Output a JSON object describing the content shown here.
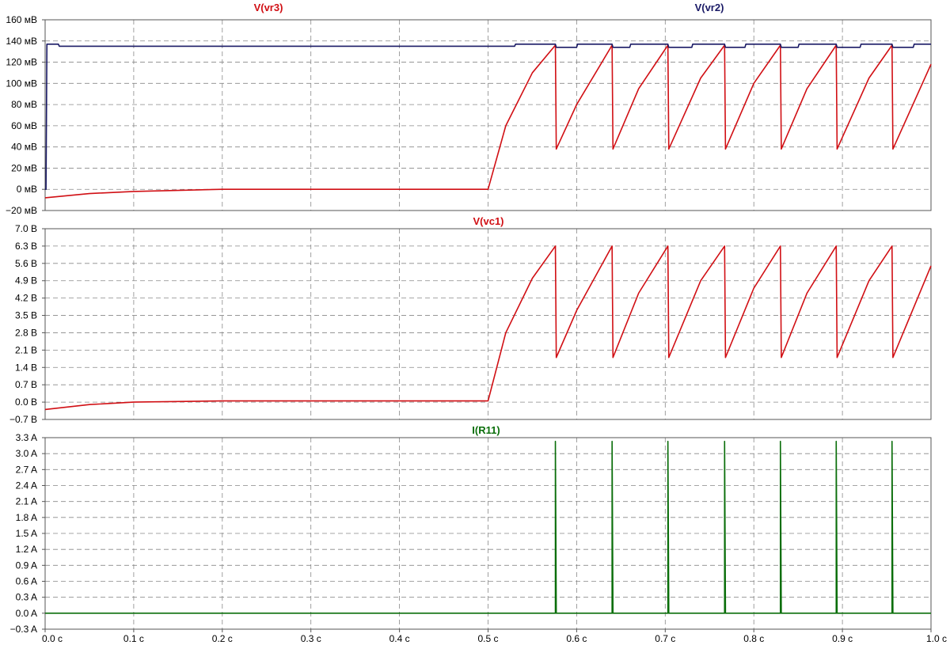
{
  "colors": {
    "vr3": "#d10f14",
    "vr2": "#1a1a66",
    "vc1": "#d10f14",
    "ir11": "#0a6e0a",
    "grid": "#888888",
    "background": "#ffffff"
  },
  "chart_data": [
    {
      "type": "line",
      "grid": true,
      "xlim": [
        0.0,
        1.0
      ],
      "ylim": [
        -20,
        160
      ],
      "x_tick_labels": [
        "0.0 с",
        "0.1 с",
        "0.2 с",
        "0.3 с",
        "0.4 с",
        "0.5 с",
        "0.6 с",
        "0.7 с",
        "0.8 с",
        "0.9 с",
        "1.0 с"
      ],
      "y_ticks": [
        -20,
        0,
        20,
        40,
        60,
        80,
        100,
        120,
        140,
        160
      ],
      "y_tick_labels": [
        "−20 мВ",
        "0 мВ",
        "20 мВ",
        "40 мВ",
        "60 мВ",
        "80 мВ",
        "100 мВ",
        "120 мВ",
        "140 мВ",
        "160 мВ"
      ],
      "series": [
        {
          "name": "V(vr3)",
          "color": "#d10f14",
          "description_points": {
            "x": [
              0.0,
              0.05,
              0.1,
              0.2,
              0.5,
              0.52,
              0.55,
              0.576,
              0.577,
              0.6,
              0.64,
              0.641,
              0.67,
              0.703,
              0.704,
              0.74,
              0.767,
              0.768,
              0.8,
              0.83,
              0.831,
              0.86,
              0.893,
              0.894,
              0.93,
              0.956,
              0.957,
              1.0
            ],
            "y": [
              -8,
              -4,
              -2,
              0,
              0,
              60,
              110,
              136,
              38,
              80,
              136,
              38,
              95,
              136,
              38,
              105,
              136,
              38,
              100,
              136,
              38,
              95,
              136,
              38,
              105,
              136,
              38,
              118
            ]
          }
        },
        {
          "name": "V(vr2)",
          "color": "#1a1a66",
          "description_points": {
            "x": [
              0.0,
              0.001,
              0.002,
              0.015,
              0.016,
              0.53,
              0.531,
              0.576,
              0.577,
              0.6,
              0.601,
              0.64,
              0.641,
              0.66,
              0.661,
              0.703,
              0.704,
              0.73,
              0.731,
              0.767,
              0.768,
              0.79,
              0.791,
              0.83,
              0.831,
              0.85,
              0.851,
              0.893,
              0.894,
              0.92,
              0.921,
              0.956,
              0.957,
              0.98,
              0.981,
              1.0
            ],
            "y": [
              0,
              0,
              137,
              137,
              135,
              135,
              137,
              137,
              134,
              134,
              137,
              137,
              134,
              134,
              137,
              137,
              134,
              134,
              137,
              137,
              134,
              134,
              137,
              137,
              134,
              134,
              137,
              137,
              134,
              134,
              137,
              137,
              134,
              134,
              137,
              137
            ]
          }
        }
      ]
    },
    {
      "type": "line",
      "grid": true,
      "xlim": [
        0.0,
        1.0
      ],
      "ylim": [
        -0.7,
        7.0
      ],
      "y_ticks": [
        -0.7,
        0.0,
        0.7,
        1.4,
        2.1,
        2.8,
        3.5,
        4.2,
        4.9,
        5.6,
        6.3,
        7.0
      ],
      "y_tick_labels": [
        "−0.7 В",
        "0.0 В",
        "0.7 В",
        "1.4 В",
        "2.1 В",
        "2.8 В",
        "3.5 В",
        "4.2 В",
        "4.9 В",
        "5.6 В",
        "6.3 В",
        "7.0 В"
      ],
      "series": [
        {
          "name": "V(vc1)",
          "color": "#d10f14",
          "description_points": {
            "x": [
              0.0,
              0.05,
              0.1,
              0.2,
              0.5,
              0.52,
              0.55,
              0.576,
              0.577,
              0.6,
              0.64,
              0.641,
              0.67,
              0.703,
              0.704,
              0.74,
              0.767,
              0.768,
              0.8,
              0.83,
              0.831,
              0.86,
              0.893,
              0.894,
              0.93,
              0.956,
              0.957,
              1.0
            ],
            "y": [
              -0.3,
              -0.1,
              0.0,
              0.05,
              0.05,
              2.8,
              5.0,
              6.3,
              1.8,
              3.7,
              6.3,
              1.8,
              4.4,
              6.3,
              1.8,
              4.9,
              6.3,
              1.8,
              4.6,
              6.3,
              1.8,
              4.4,
              6.3,
              1.8,
              4.9,
              6.3,
              1.8,
              5.5
            ]
          }
        }
      ]
    },
    {
      "type": "line",
      "grid": true,
      "xlim": [
        0.0,
        1.0
      ],
      "ylim": [
        -0.3,
        3.3
      ],
      "y_ticks": [
        -0.3,
        0.0,
        0.3,
        0.6,
        0.9,
        1.2,
        1.5,
        1.8,
        2.1,
        2.4,
        2.7,
        3.0,
        3.3
      ],
      "y_tick_labels": [
        "−0.3 A",
        "0.0 A",
        "0.3 A",
        "0.6 A",
        "0.9 A",
        "1.2 A",
        "1.5 A",
        "1.8 A",
        "2.1 A",
        "2.4 A",
        "2.7 A",
        "3.0 A",
        "3.3 A"
      ],
      "series": [
        {
          "name": "I(R11)",
          "color": "#0a6e0a",
          "description_points": {
            "x": [
              0.0,
              0.576,
              0.576,
              0.577,
              0.64,
              0.64,
              0.641,
              0.703,
              0.703,
              0.704,
              0.767,
              0.767,
              0.768,
              0.83,
              0.83,
              0.831,
              0.893,
              0.893,
              0.894,
              0.956,
              0.956,
              0.957,
              1.0
            ],
            "y": [
              0.0,
              0.0,
              3.23,
              0.0,
              0.0,
              3.23,
              0.0,
              0.0,
              3.23,
              0.0,
              0.0,
              3.23,
              0.0,
              0.0,
              3.23,
              0.0,
              0.0,
              3.23,
              0.0,
              0.0,
              3.23,
              0.0,
              0.0
            ]
          }
        }
      ]
    }
  ]
}
